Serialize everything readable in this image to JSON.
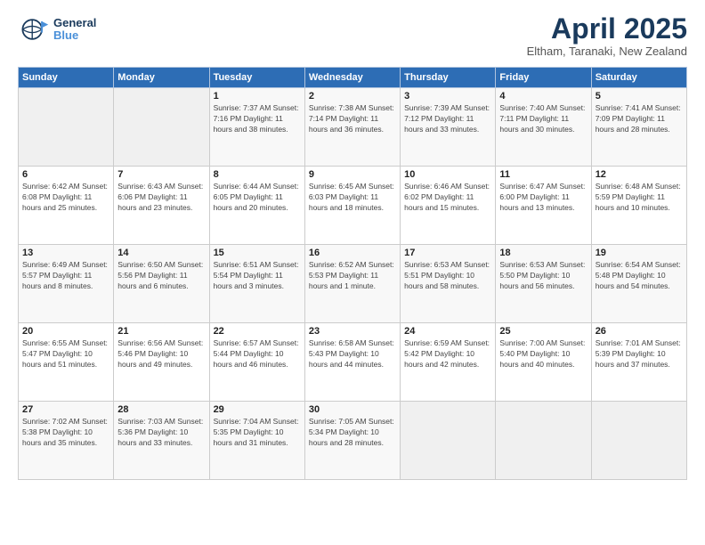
{
  "header": {
    "logo_general": "General",
    "logo_blue": "Blue",
    "month_title": "April 2025",
    "subtitle": "Eltham, Taranaki, New Zealand"
  },
  "days_of_week": [
    "Sunday",
    "Monday",
    "Tuesday",
    "Wednesday",
    "Thursday",
    "Friday",
    "Saturday"
  ],
  "weeks": [
    [
      {
        "day": "",
        "info": ""
      },
      {
        "day": "",
        "info": ""
      },
      {
        "day": "1",
        "info": "Sunrise: 7:37 AM\nSunset: 7:16 PM\nDaylight: 11 hours and 38 minutes."
      },
      {
        "day": "2",
        "info": "Sunrise: 7:38 AM\nSunset: 7:14 PM\nDaylight: 11 hours and 36 minutes."
      },
      {
        "day": "3",
        "info": "Sunrise: 7:39 AM\nSunset: 7:12 PM\nDaylight: 11 hours and 33 minutes."
      },
      {
        "day": "4",
        "info": "Sunrise: 7:40 AM\nSunset: 7:11 PM\nDaylight: 11 hours and 30 minutes."
      },
      {
        "day": "5",
        "info": "Sunrise: 7:41 AM\nSunset: 7:09 PM\nDaylight: 11 hours and 28 minutes."
      }
    ],
    [
      {
        "day": "6",
        "info": "Sunrise: 6:42 AM\nSunset: 6:08 PM\nDaylight: 11 hours and 25 minutes."
      },
      {
        "day": "7",
        "info": "Sunrise: 6:43 AM\nSunset: 6:06 PM\nDaylight: 11 hours and 23 minutes."
      },
      {
        "day": "8",
        "info": "Sunrise: 6:44 AM\nSunset: 6:05 PM\nDaylight: 11 hours and 20 minutes."
      },
      {
        "day": "9",
        "info": "Sunrise: 6:45 AM\nSunset: 6:03 PM\nDaylight: 11 hours and 18 minutes."
      },
      {
        "day": "10",
        "info": "Sunrise: 6:46 AM\nSunset: 6:02 PM\nDaylight: 11 hours and 15 minutes."
      },
      {
        "day": "11",
        "info": "Sunrise: 6:47 AM\nSunset: 6:00 PM\nDaylight: 11 hours and 13 minutes."
      },
      {
        "day": "12",
        "info": "Sunrise: 6:48 AM\nSunset: 5:59 PM\nDaylight: 11 hours and 10 minutes."
      }
    ],
    [
      {
        "day": "13",
        "info": "Sunrise: 6:49 AM\nSunset: 5:57 PM\nDaylight: 11 hours and 8 minutes."
      },
      {
        "day": "14",
        "info": "Sunrise: 6:50 AM\nSunset: 5:56 PM\nDaylight: 11 hours and 6 minutes."
      },
      {
        "day": "15",
        "info": "Sunrise: 6:51 AM\nSunset: 5:54 PM\nDaylight: 11 hours and 3 minutes."
      },
      {
        "day": "16",
        "info": "Sunrise: 6:52 AM\nSunset: 5:53 PM\nDaylight: 11 hours and 1 minute."
      },
      {
        "day": "17",
        "info": "Sunrise: 6:53 AM\nSunset: 5:51 PM\nDaylight: 10 hours and 58 minutes."
      },
      {
        "day": "18",
        "info": "Sunrise: 6:53 AM\nSunset: 5:50 PM\nDaylight: 10 hours and 56 minutes."
      },
      {
        "day": "19",
        "info": "Sunrise: 6:54 AM\nSunset: 5:48 PM\nDaylight: 10 hours and 54 minutes."
      }
    ],
    [
      {
        "day": "20",
        "info": "Sunrise: 6:55 AM\nSunset: 5:47 PM\nDaylight: 10 hours and 51 minutes."
      },
      {
        "day": "21",
        "info": "Sunrise: 6:56 AM\nSunset: 5:46 PM\nDaylight: 10 hours and 49 minutes."
      },
      {
        "day": "22",
        "info": "Sunrise: 6:57 AM\nSunset: 5:44 PM\nDaylight: 10 hours and 46 minutes."
      },
      {
        "day": "23",
        "info": "Sunrise: 6:58 AM\nSunset: 5:43 PM\nDaylight: 10 hours and 44 minutes."
      },
      {
        "day": "24",
        "info": "Sunrise: 6:59 AM\nSunset: 5:42 PM\nDaylight: 10 hours and 42 minutes."
      },
      {
        "day": "25",
        "info": "Sunrise: 7:00 AM\nSunset: 5:40 PM\nDaylight: 10 hours and 40 minutes."
      },
      {
        "day": "26",
        "info": "Sunrise: 7:01 AM\nSunset: 5:39 PM\nDaylight: 10 hours and 37 minutes."
      }
    ],
    [
      {
        "day": "27",
        "info": "Sunrise: 7:02 AM\nSunset: 5:38 PM\nDaylight: 10 hours and 35 minutes."
      },
      {
        "day": "28",
        "info": "Sunrise: 7:03 AM\nSunset: 5:36 PM\nDaylight: 10 hours and 33 minutes."
      },
      {
        "day": "29",
        "info": "Sunrise: 7:04 AM\nSunset: 5:35 PM\nDaylight: 10 hours and 31 minutes."
      },
      {
        "day": "30",
        "info": "Sunrise: 7:05 AM\nSunset: 5:34 PM\nDaylight: 10 hours and 28 minutes."
      },
      {
        "day": "",
        "info": ""
      },
      {
        "day": "",
        "info": ""
      },
      {
        "day": "",
        "info": ""
      }
    ]
  ]
}
